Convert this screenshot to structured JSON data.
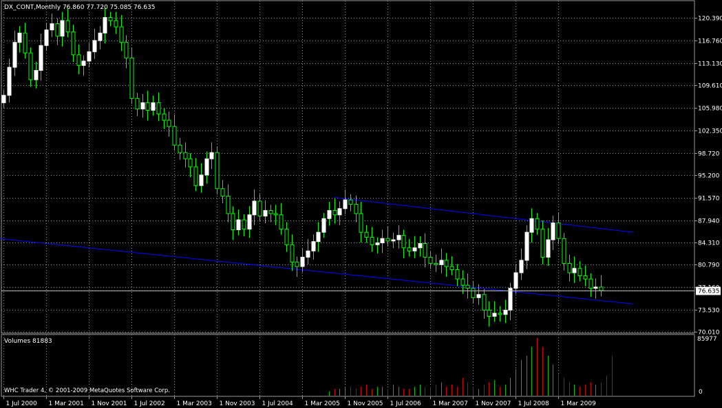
{
  "header": {
    "symbol_info": "DX_CONT,Monthly  76.860 77.720 75.085 76.635"
  },
  "volume_panel": {
    "label": "Volumes 81883",
    "max_label": "85977",
    "zero_label": "0"
  },
  "copyright": "WHC Trader 4, © 2001-2009 MetaQuotes Software Corp.",
  "colors": {
    "background": "#000000",
    "grid": "#9a9a9a",
    "up_candle_body": "#ffffff",
    "candle_wick": "#00ff00",
    "trendline": "#0000ff",
    "current_price_line": "#c0c0c0",
    "volume_up": "#00c000",
    "volume_down": "#d00000"
  },
  "chart_data": {
    "type": "candlestick",
    "timeframe": "Monthly",
    "symbol": "DX_CONT",
    "y_axis": {
      "ticks": [
        120.39,
        116.76,
        113.13,
        109.61,
        105.98,
        102.35,
        98.72,
        95.2,
        91.57,
        87.94,
        84.31,
        80.79,
        77.16,
        73.53,
        70.01
      ],
      "tick_labels": [
        "120.390",
        "116.760",
        "113.130",
        "109.610",
        "105.980",
        "102.350",
        "98.720",
        "95.200",
        "91.570",
        "87.940",
        "84.310",
        "80.790",
        "77.160",
        "73.530",
        "70.010"
      ],
      "ylim": [
        69.8,
        123.2
      ],
      "current_price": 76.635,
      "current_price_label": "76.635"
    },
    "x_axis": {
      "tick_labels": [
        "1 Jul 2000",
        "1 Mar 2001",
        "1 Nov 2001",
        "1 Jul 2002",
        "1 Mar 2003",
        "1 Nov 2003",
        "1 Jul 2004",
        "1 Mar 2005",
        "1 Nov 2005",
        "1 Jul 2006",
        "1 Mar 2007",
        "1 Nov 2007",
        "1 Jul 2008",
        "1 Mar 2009"
      ],
      "tick_month_index": [
        0,
        8,
        16,
        24,
        32,
        40,
        48,
        56,
        64,
        72,
        80,
        88,
        96,
        104
      ],
      "last_month_index": 115
    },
    "closes": [
      108.0,
      112.5,
      116.5,
      118.0,
      114.8,
      110.5,
      112.0,
      116.0,
      118.5,
      119.5,
      117.5,
      120.0,
      118.2,
      114.5,
      112.8,
      113.5,
      115.0,
      116.8,
      118.0,
      120.5,
      120.0,
      119.0,
      116.5,
      114.0,
      107.5,
      105.8,
      106.8,
      105.6,
      106.8,
      105.0,
      104.0,
      103.0,
      100.0,
      98.8,
      97.8,
      96.5,
      93.5,
      95.2,
      97.8,
      98.8,
      93.0,
      91.8,
      89.0,
      86.4,
      88.0,
      86.5,
      88.8,
      91.0,
      88.6,
      89.5,
      89.0,
      88.8,
      86.5,
      84.0,
      81.2,
      80.5,
      82.0,
      83.0,
      84.5,
      86.0,
      88.2,
      89.5,
      88.8,
      89.8,
      91.2,
      90.5,
      89.0,
      86.0,
      85.2,
      84.0,
      84.3,
      85.0,
      84.6,
      84.8,
      85.5,
      83.5,
      83.0,
      83.5,
      84.2,
      82.0,
      81.0,
      80.8,
      81.5,
      80.5,
      80.0,
      78.5,
      77.5,
      77.0,
      75.5,
      76.0,
      73.5,
      72.5,
      73.0,
      72.8,
      73.5,
      77.0,
      79.5,
      81.5,
      86.0,
      88.2,
      86.5,
      82.0,
      84.8,
      87.5,
      85.0,
      81.0,
      79.5,
      80.2,
      79.0,
      78.5,
      77.0,
      77.2,
      76.635
    ],
    "volumes": [
      0,
      0,
      0,
      0,
      0,
      0,
      0,
      0,
      0,
      0,
      0,
      0,
      0,
      0,
      0,
      0,
      0,
      0,
      0,
      0,
      0,
      0,
      0,
      0,
      0,
      0,
      0,
      0,
      0,
      0,
      0,
      0,
      0,
      0,
      0,
      0,
      0,
      0,
      0,
      0,
      0,
      0,
      0,
      0,
      0,
      0,
      0,
      0,
      0,
      0,
      0,
      0,
      0,
      0,
      0,
      0,
      0,
      0,
      0,
      0,
      0,
      2,
      3,
      3,
      4,
      4,
      3,
      4,
      5,
      3,
      4,
      4,
      3,
      5,
      4,
      3,
      3,
      4,
      5,
      4,
      4,
      5,
      6,
      4,
      5,
      4,
      8,
      6,
      4,
      3,
      5,
      6,
      7,
      4,
      5,
      8,
      12,
      16,
      18,
      22,
      26,
      22,
      18,
      14,
      10,
      8,
      6,
      5,
      4,
      5,
      6,
      5,
      6,
      9,
      18
    ],
    "trendlines": [
      {
        "from": {
          "month": -1,
          "price": 85.0
        },
        "to": {
          "month": 118,
          "price": 74.5
        }
      },
      {
        "from": {
          "month": 62,
          "price": 91.6
        },
        "to": {
          "month": 118,
          "price": 86.0
        }
      }
    ]
  }
}
